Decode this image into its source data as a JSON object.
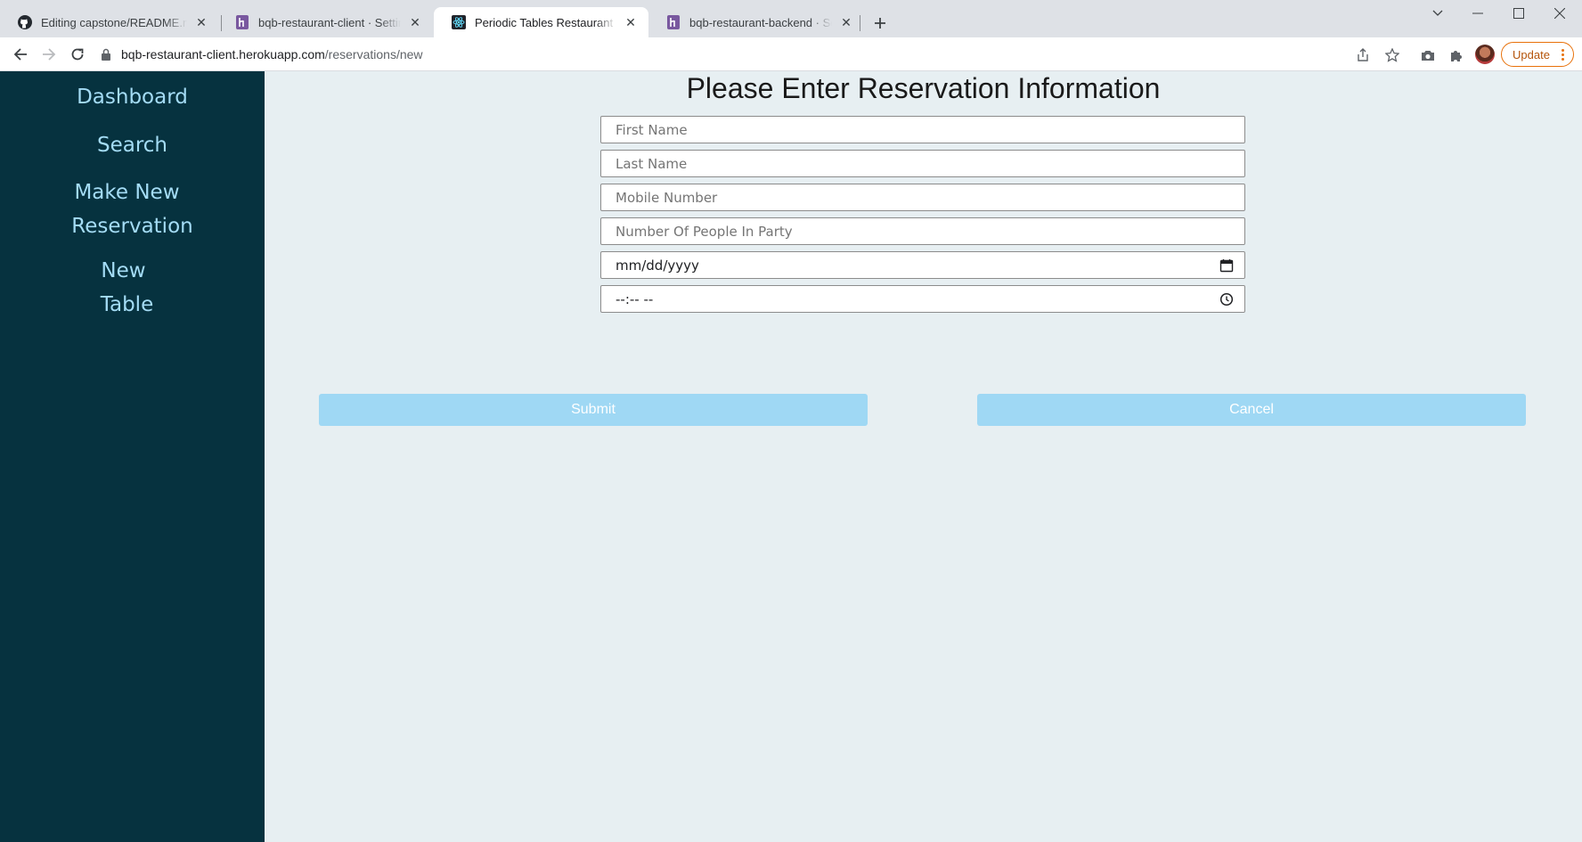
{
  "browser": {
    "tabs": [
      {
        "title": "Editing capstone/README.md at main",
        "icon": "github-icon"
      },
      {
        "title": "bqb-restaurant-client · Settings | Heroku",
        "icon": "heroku-icon"
      },
      {
        "title": "Periodic Tables Restaurant Reservation",
        "icon": "react-icon",
        "active": true
      },
      {
        "title": "bqb-restaurant-backend · Settings | Heroku",
        "icon": "heroku-icon"
      }
    ],
    "url_host": "bqb-restaurant-client.herokuapp.com",
    "url_path": "/reservations/new",
    "update_label": "Update"
  },
  "sidebar": {
    "items": [
      {
        "lines": [
          "Dashboard"
        ]
      },
      {
        "lines": [
          "Search"
        ]
      },
      {
        "lines": [
          "Make New",
          "Reservation"
        ]
      },
      {
        "lines": [
          "New",
          "Table"
        ]
      }
    ]
  },
  "form": {
    "title": "Please Enter Reservation Information",
    "first_name_placeholder": "First Name",
    "last_name_placeholder": "Last Name",
    "mobile_placeholder": "Mobile Number",
    "people_placeholder": "Number Of People In Party",
    "date_value": "mm/dd/yyyy",
    "time_value": "--:-- --",
    "submit_label": "Submit",
    "cancel_label": "Cancel"
  },
  "colors": {
    "sidebar_bg": "#06323f",
    "sidebar_link": "#a4dcf5",
    "page_bg": "#e7eff2",
    "button_bg": "#9fd8f4"
  }
}
